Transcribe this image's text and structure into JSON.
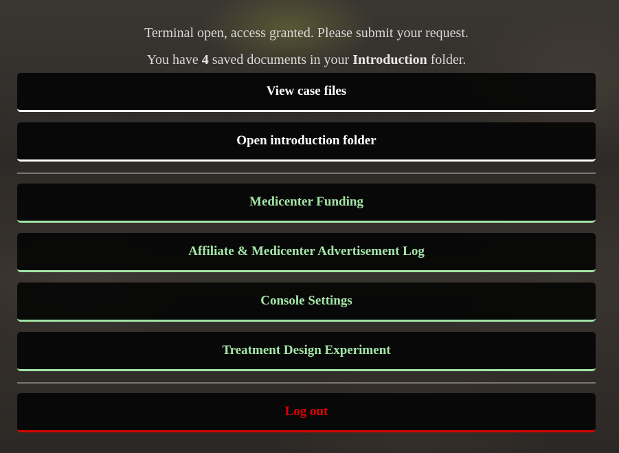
{
  "intro": {
    "line1": "Terminal open, access granted. Please submit your request.",
    "line2_prefix": "You have ",
    "document_count": "4",
    "line2_middle": " saved documents in your ",
    "folder_name": "Introduction",
    "line2_suffix": " folder."
  },
  "primary_actions": [
    {
      "label": "View case files"
    },
    {
      "label": "Open introduction folder"
    }
  ],
  "menu_items": [
    {
      "label": "Medicenter Funding"
    },
    {
      "label": "Affiliate & Medicenter Advertisement Log"
    },
    {
      "label": "Console Settings"
    },
    {
      "label": "Treatment Design Experiment"
    }
  ],
  "logout": {
    "label": "Log out"
  },
  "colors": {
    "primary": "#ffffff",
    "menu_accent": "#a3e6a7",
    "logout_accent": "#e00000",
    "button_bg": "#050505"
  }
}
